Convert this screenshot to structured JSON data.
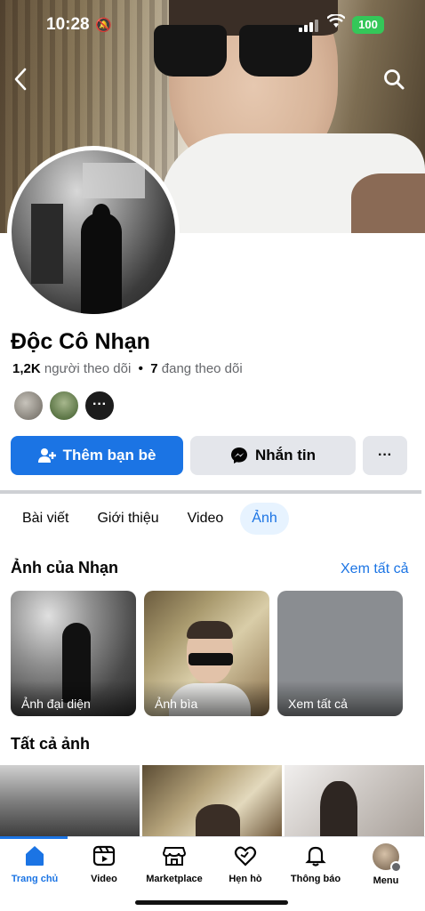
{
  "status_bar": {
    "time": "10:28",
    "battery": "100"
  },
  "profile": {
    "name": "Độc Cô Nhạn",
    "followers_count": "1,2K",
    "followers_label": "người theo dõi",
    "separator": "•",
    "following_count": "7",
    "following_label": "đang theo dõi",
    "friend_more": "···"
  },
  "actions": {
    "add_friend": "Thêm bạn bè",
    "message": "Nhắn tin",
    "more": "···"
  },
  "tabs": [
    "Bài viết",
    "Giới thiệu",
    "Video",
    "Ảnh"
  ],
  "active_tab": "Ảnh",
  "albums_section": {
    "title": "Ảnh của Nhạn",
    "see_all": "Xem tất cả",
    "albums": [
      {
        "label": "Ảnh đại diện"
      },
      {
        "label": "Ảnh bìa"
      },
      {
        "label": "Xem tất cả"
      }
    ]
  },
  "all_photos": {
    "title": "Tất cả ảnh"
  },
  "bottom_nav": [
    {
      "label": "Trang chủ",
      "icon": "home-icon"
    },
    {
      "label": "Video",
      "icon": "video-icon"
    },
    {
      "label": "Marketplace",
      "icon": "marketplace-icon"
    },
    {
      "label": "Hẹn hò",
      "icon": "dating-icon"
    },
    {
      "label": "Thông báo",
      "icon": "bell-icon"
    },
    {
      "label": "Menu",
      "icon": "menu-avatar"
    }
  ],
  "colors": {
    "accent": "#1b74e4",
    "battery": "#34c759"
  }
}
